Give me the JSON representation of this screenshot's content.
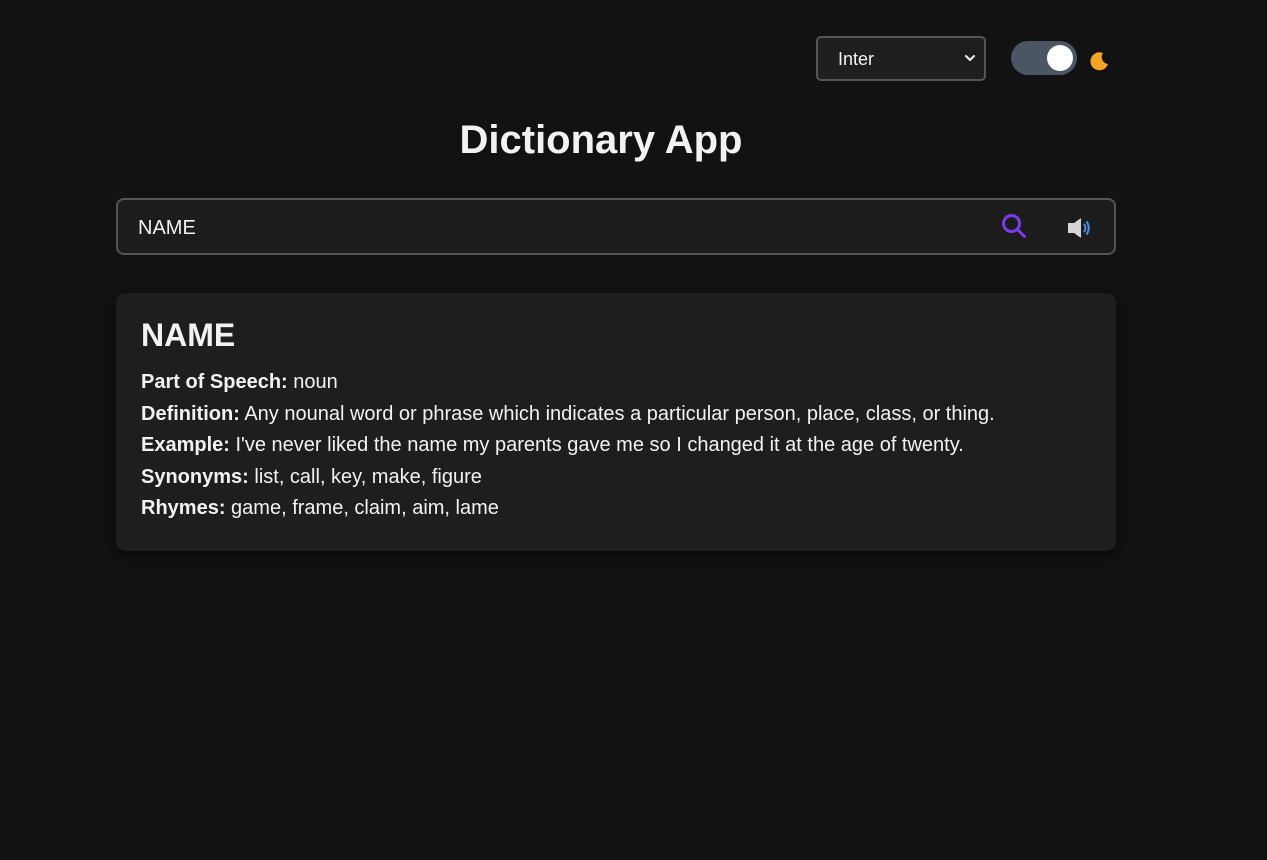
{
  "controls": {
    "font_select": {
      "selected": "Inter"
    },
    "theme_toggle": {
      "state": "dark"
    },
    "moon_icon": "moon-icon"
  },
  "header": {
    "title": "Dictionary App"
  },
  "search": {
    "value": "NAME",
    "search_icon": "search-icon",
    "speaker_icon": "speaker-icon",
    "accent_color": "#7c3aed"
  },
  "result": {
    "word": "NAME",
    "part_of_speech_label": "Part of Speech:",
    "part_of_speech": "noun",
    "definition_label": "Definition:",
    "definition": "Any nounal word or phrase which indicates a particular person, place, class, or thing.",
    "example_label": "Example:",
    "example": "I've never liked the name my parents gave me so I changed it at the age of twenty.",
    "synonyms_label": "Synonyms:",
    "synonyms": "list, call, key, make, figure",
    "rhymes_label": "Rhymes:",
    "rhymes": "game, frame, claim, aim, lame"
  }
}
